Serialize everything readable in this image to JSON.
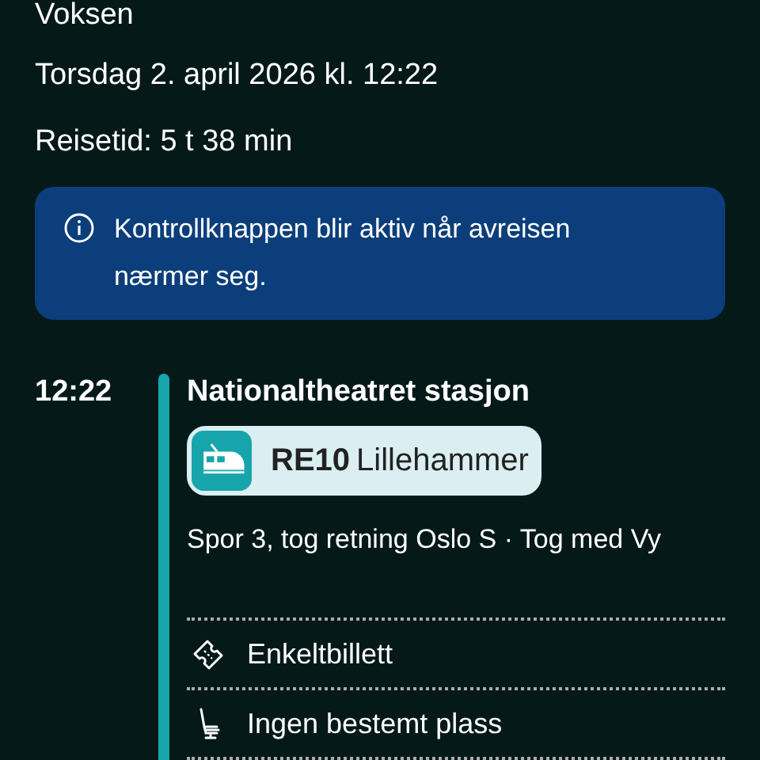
{
  "passenger": "Voksen",
  "date": "Torsdag 2. april 2026 kl. 12:22",
  "travel_time": "Reisetid: 5 t 38 min",
  "info": "Kontrollknappen blir aktiv når avreisen nærmer seg.",
  "leg": {
    "time": "12:22",
    "station": "Nationaltheatret stasjon",
    "line": "RE10",
    "destination": "Lillehammer",
    "details": "Spor 3, tog retning Oslo S · Tog med Vy",
    "items": [
      {
        "kind": "ticket",
        "label": "Enkeltbillett"
      },
      {
        "kind": "seat",
        "label": "Ingen bestemt plass"
      }
    ]
  }
}
